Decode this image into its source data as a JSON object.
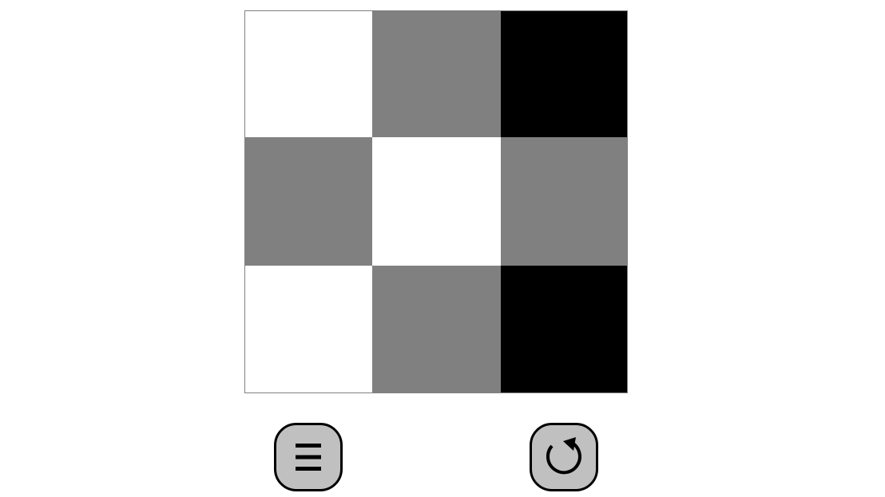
{
  "board": {
    "rows": 3,
    "cols": 3,
    "colors": {
      "white": "#ffffff",
      "gray": "#808080",
      "black": "#000000"
    },
    "cells": [
      [
        "white",
        "gray",
        "black"
      ],
      [
        "gray",
        "white",
        "gray"
      ],
      [
        "white",
        "gray",
        "black"
      ]
    ]
  },
  "controls": {
    "menu_icon": "menu-icon",
    "reset_icon": "reset-icon",
    "button_color": "#c0c0c0"
  }
}
